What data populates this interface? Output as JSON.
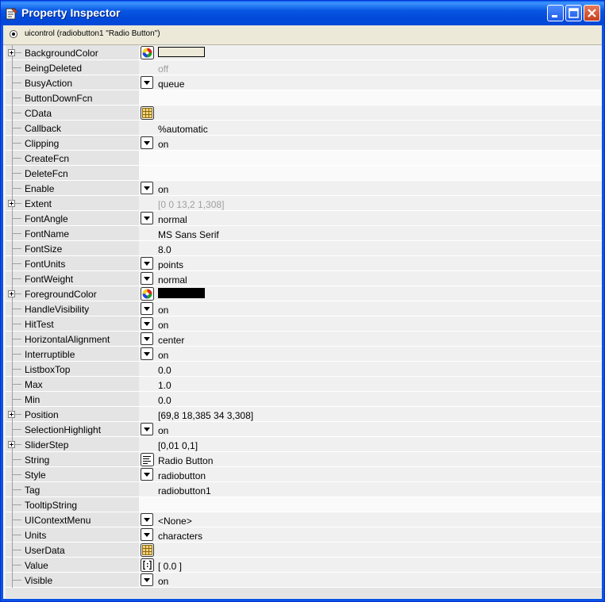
{
  "window": {
    "title": "Property Inspector",
    "object_label": "uicontrol (radiobutton1 \"Radio Button\")"
  },
  "colors": {
    "title_bar": "#0349d9",
    "background_color_value": "#ece9d8",
    "foreground_color_value": "#000000"
  },
  "properties": [
    {
      "name": "BackgroundColor",
      "expandable": true,
      "editor": "color",
      "value": "",
      "swatch": "#ece9d8"
    },
    {
      "name": "BeingDeleted",
      "expandable": false,
      "editor": "none",
      "value": "off",
      "dim": true
    },
    {
      "name": "BusyAction",
      "expandable": false,
      "editor": "dropdown",
      "value": "queue"
    },
    {
      "name": "ButtonDownFcn",
      "expandable": false,
      "editor": "none",
      "value": "",
      "white": true
    },
    {
      "name": "CData",
      "expandable": false,
      "editor": "matrix",
      "value": ""
    },
    {
      "name": "Callback",
      "expandable": false,
      "editor": "none",
      "value": "%automatic"
    },
    {
      "name": "Clipping",
      "expandable": false,
      "editor": "dropdown",
      "value": "on"
    },
    {
      "name": "CreateFcn",
      "expandable": false,
      "editor": "none",
      "value": "",
      "white": true
    },
    {
      "name": "DeleteFcn",
      "expandable": false,
      "editor": "none",
      "value": "",
      "white": true
    },
    {
      "name": "Enable",
      "expandable": false,
      "editor": "dropdown",
      "value": "on"
    },
    {
      "name": "Extent",
      "expandable": true,
      "editor": "none",
      "value": "[0 0 13,2 1,308]",
      "dim": true
    },
    {
      "name": "FontAngle",
      "expandable": false,
      "editor": "dropdown",
      "value": "normal"
    },
    {
      "name": "FontName",
      "expandable": false,
      "editor": "none",
      "value": "MS Sans Serif"
    },
    {
      "name": "FontSize",
      "expandable": false,
      "editor": "none",
      "value": "8.0"
    },
    {
      "name": "FontUnits",
      "expandable": false,
      "editor": "dropdown",
      "value": "points"
    },
    {
      "name": "FontWeight",
      "expandable": false,
      "editor": "dropdown",
      "value": "normal"
    },
    {
      "name": "ForegroundColor",
      "expandable": true,
      "editor": "color",
      "value": "",
      "swatch": "#000000"
    },
    {
      "name": "HandleVisibility",
      "expandable": false,
      "editor": "dropdown",
      "value": "on"
    },
    {
      "name": "HitTest",
      "expandable": false,
      "editor": "dropdown",
      "value": "on"
    },
    {
      "name": "HorizontalAlignment",
      "expandable": false,
      "editor": "dropdown",
      "value": "center"
    },
    {
      "name": "Interruptible",
      "expandable": false,
      "editor": "dropdown",
      "value": "on"
    },
    {
      "name": "ListboxTop",
      "expandable": false,
      "editor": "none",
      "value": "0.0"
    },
    {
      "name": "Max",
      "expandable": false,
      "editor": "none",
      "value": "1.0"
    },
    {
      "name": "Min",
      "expandable": false,
      "editor": "none",
      "value": "0.0"
    },
    {
      "name": "Position",
      "expandable": true,
      "editor": "none",
      "value": "[69,8 18,385 34 3,308]"
    },
    {
      "name": "SelectionHighlight",
      "expandable": false,
      "editor": "dropdown",
      "value": "on"
    },
    {
      "name": "SliderStep",
      "expandable": true,
      "editor": "none",
      "value": "[0,01 0,1]"
    },
    {
      "name": "String",
      "expandable": false,
      "editor": "text",
      "value": "Radio Button"
    },
    {
      "name": "Style",
      "expandable": false,
      "editor": "dropdown",
      "value": "radiobutton"
    },
    {
      "name": "Tag",
      "expandable": false,
      "editor": "none",
      "value": "radiobutton1"
    },
    {
      "name": "TooltipString",
      "expandable": false,
      "editor": "none",
      "value": "",
      "white": true
    },
    {
      "name": "UIContextMenu",
      "expandable": false,
      "editor": "dropdown",
      "value": "<None>"
    },
    {
      "name": "Units",
      "expandable": false,
      "editor": "dropdown",
      "value": "characters"
    },
    {
      "name": "UserData",
      "expandable": false,
      "editor": "matrix",
      "value": ""
    },
    {
      "name": "Value",
      "expandable": false,
      "editor": "array",
      "value": "[ 0.0 ]"
    },
    {
      "name": "Visible",
      "expandable": false,
      "editor": "dropdown",
      "value": "on"
    }
  ]
}
